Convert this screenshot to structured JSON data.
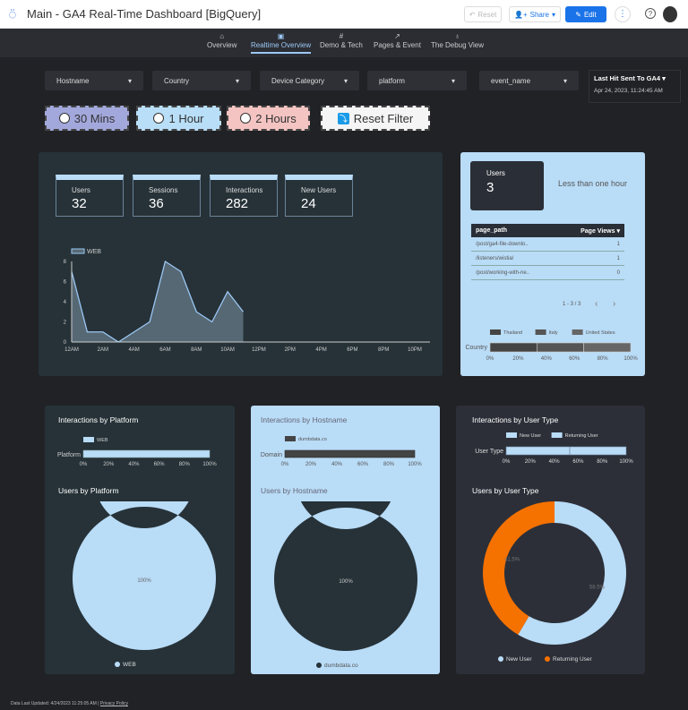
{
  "header": {
    "title": "Main - GA4 Real-Time Dashboard [BigQuery]",
    "reset": "Reset",
    "share": "Share",
    "edit": "Edit"
  },
  "nav": {
    "tabs": [
      {
        "label": "Overview",
        "icon": "home-icon"
      },
      {
        "label": "Realtime Overview",
        "icon": "report-icon",
        "active": true
      },
      {
        "label": "Demo & Tech",
        "icon": "hash-icon"
      },
      {
        "label": "Pages & Event",
        "icon": "trend-icon"
      },
      {
        "label": "The Debug View",
        "icon": "bulb-icon"
      }
    ]
  },
  "filters": {
    "hostname": "Hostname",
    "country": "Country",
    "device": "Device Category",
    "platform": "platform",
    "event": "event_name",
    "last_hit_label": "Last Hit Sent To GA4",
    "last_hit_value": "Apr 24, 2023, 11:24:45 AM"
  },
  "buttons": {
    "m30": "30 Mins",
    "h1": "1 Hour",
    "h2": "2 Hours",
    "reset": "Reset Filter"
  },
  "colors": {
    "m30": "#a3a8dc",
    "h1": "#b9dff8",
    "h2": "#f3c4c2",
    "accent": "#b9dcf7",
    "orange": "#f57100"
  },
  "scorecards": [
    {
      "label": "Users",
      "value": "32"
    },
    {
      "label": "Sessions",
      "value": "36"
    },
    {
      "label": "Interactions",
      "value": "282"
    },
    {
      "label": "New Users",
      "value": "24"
    }
  ],
  "chart_data": [
    {
      "type": "area",
      "series": [
        {
          "name": "WEB",
          "values": [
            7,
            1,
            1,
            0,
            1,
            2,
            8,
            7,
            3,
            2,
            5,
            3
          ]
        }
      ],
      "x": [
        "12AM",
        "1AM",
        "2AM",
        "3AM",
        "4AM",
        "5AM",
        "6AM",
        "7AM",
        "8AM",
        "9AM",
        "10AM",
        "11AM"
      ],
      "xticks": [
        "12AM",
        "2AM",
        "4AM",
        "6AM",
        "8AM",
        "10AM",
        "12PM",
        "2PM",
        "4PM",
        "6PM",
        "8PM",
        "10PM"
      ],
      "yticks": [
        "0",
        "2",
        "4",
        "6",
        "8"
      ],
      "ylim": [
        0,
        8
      ]
    },
    {
      "type": "bar",
      "title": "Country",
      "categories": [
        "Thailand",
        "Italy",
        "United States"
      ],
      "values": [
        33.3,
        33.3,
        33.4
      ],
      "xticks": [
        "0%",
        "20%",
        "40%",
        "60%",
        "80%",
        "100%"
      ]
    },
    {
      "type": "bar",
      "title": "Interactions by Platform",
      "label": "Platform",
      "categories": [
        "WEB"
      ],
      "values": [
        100
      ]
    },
    {
      "type": "bar",
      "title": "Interactions by Hostname",
      "label": "Domain",
      "categories": [
        "dumbdata.co"
      ],
      "values": [
        100
      ]
    },
    {
      "type": "bar",
      "title": "Interactions by User Type",
      "label": "User Type",
      "categories": [
        "New User",
        "Returning User"
      ],
      "values": [
        53,
        47
      ]
    },
    {
      "type": "pie",
      "title": "Users by Platform",
      "categories": [
        "WEB"
      ],
      "values": [
        100
      ],
      "labels": [
        "100%"
      ]
    },
    {
      "type": "pie",
      "title": "Users by Hostname",
      "categories": [
        "dumbdata.co"
      ],
      "values": [
        100
      ],
      "labels": [
        "100%"
      ]
    },
    {
      "type": "pie",
      "title": "Users by User Type",
      "categories": [
        "New User",
        "Returning User"
      ],
      "values": [
        58.5,
        41.5
      ],
      "labels": [
        "58.5%",
        "41.5%"
      ]
    }
  ],
  "realtime": {
    "users_label": "Users",
    "users_value": "3",
    "period": "Less than one hour",
    "table": {
      "headers": [
        "page_path",
        "Page Views"
      ],
      "rows": [
        [
          "/post/ga4-file-downlo..",
          "1"
        ],
        [
          "/listeners/wistia/",
          "1"
        ],
        [
          "/post/working-with-ne..",
          "0"
        ]
      ],
      "pagination": "1 - 3 / 3"
    }
  },
  "footer": {
    "updated": "Data Last Updated: 4/24/2023 11:25:05 AM",
    "privacy": "Privacy Policy"
  }
}
